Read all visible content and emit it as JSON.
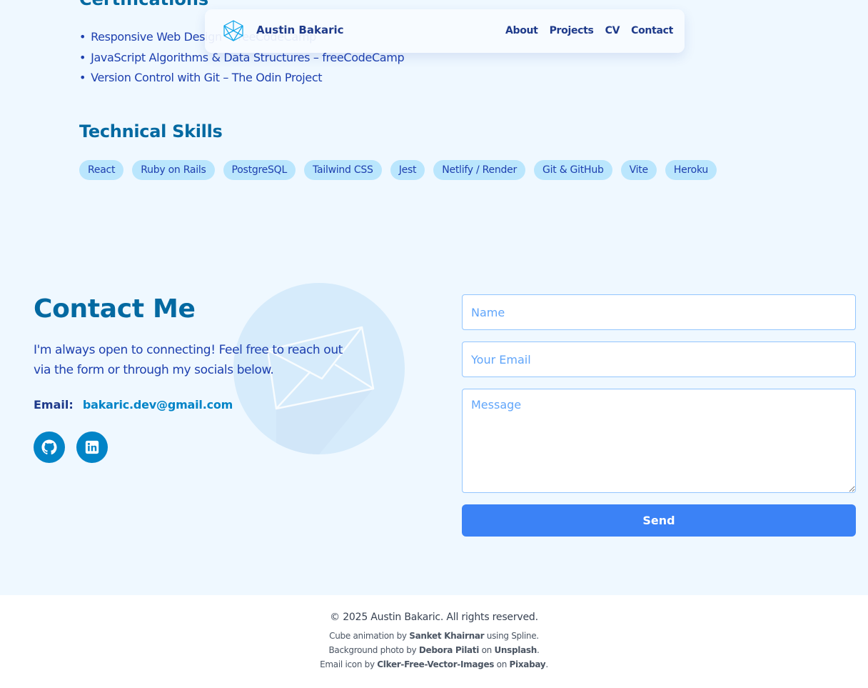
{
  "certifications": {
    "title": "Certifications",
    "items": [
      "Responsive Web Design – freeCodeCamp",
      "JavaScript Algorithms & Data Structures – freeCodeCamp",
      "Version Control with Git – The Odin Project"
    ]
  },
  "skills": {
    "title": "Technical Skills",
    "items": [
      "React",
      "Ruby on Rails",
      "PostgreSQL",
      "Tailwind CSS",
      "Jest",
      "Netlify / Render",
      "Git & GitHub",
      "Vite",
      "Heroku"
    ]
  },
  "nav": {
    "brand": "Austin Bakaric",
    "logo_icon": "wireframe-cube-icon",
    "links": [
      "About",
      "Projects",
      "CV",
      "Contact"
    ]
  },
  "contact": {
    "title": "Contact Me",
    "intro": "I'm always open to connecting! Feel free to reach out via the form or through my socials below.",
    "email_label": "Email:",
    "email": "bakaric.dev@gmail.com",
    "socials": [
      {
        "icon": "github-icon"
      },
      {
        "icon": "linkedin-icon"
      }
    ],
    "form": {
      "name_placeholder": "Name",
      "email_placeholder": "Your Email",
      "message_placeholder": "Message",
      "submit_label": "Send"
    }
  },
  "footer": {
    "copyright": "© 2025 Austin Bakaric. All rights reserved.",
    "credit1": {
      "a": "Cube animation by ",
      "b": "Sanket Khairnar",
      "c": " using Spline."
    },
    "credit2": {
      "a": "Background photo by ",
      "b": "Debora Pilati",
      "c": " on ",
      "d": "Unsplash",
      "e": "."
    },
    "credit3": {
      "a": "Email icon by ",
      "b": "Clker-Free-Vector-Images",
      "c": " on ",
      "d": "Pixabay",
      "e": "."
    }
  },
  "colors": {
    "page_bg": "#eff8ff",
    "heading": "#0369a1",
    "text": "#1e40af",
    "accent": "#0284c7",
    "button": "#3b82f6",
    "chip": "#bae6fd"
  }
}
